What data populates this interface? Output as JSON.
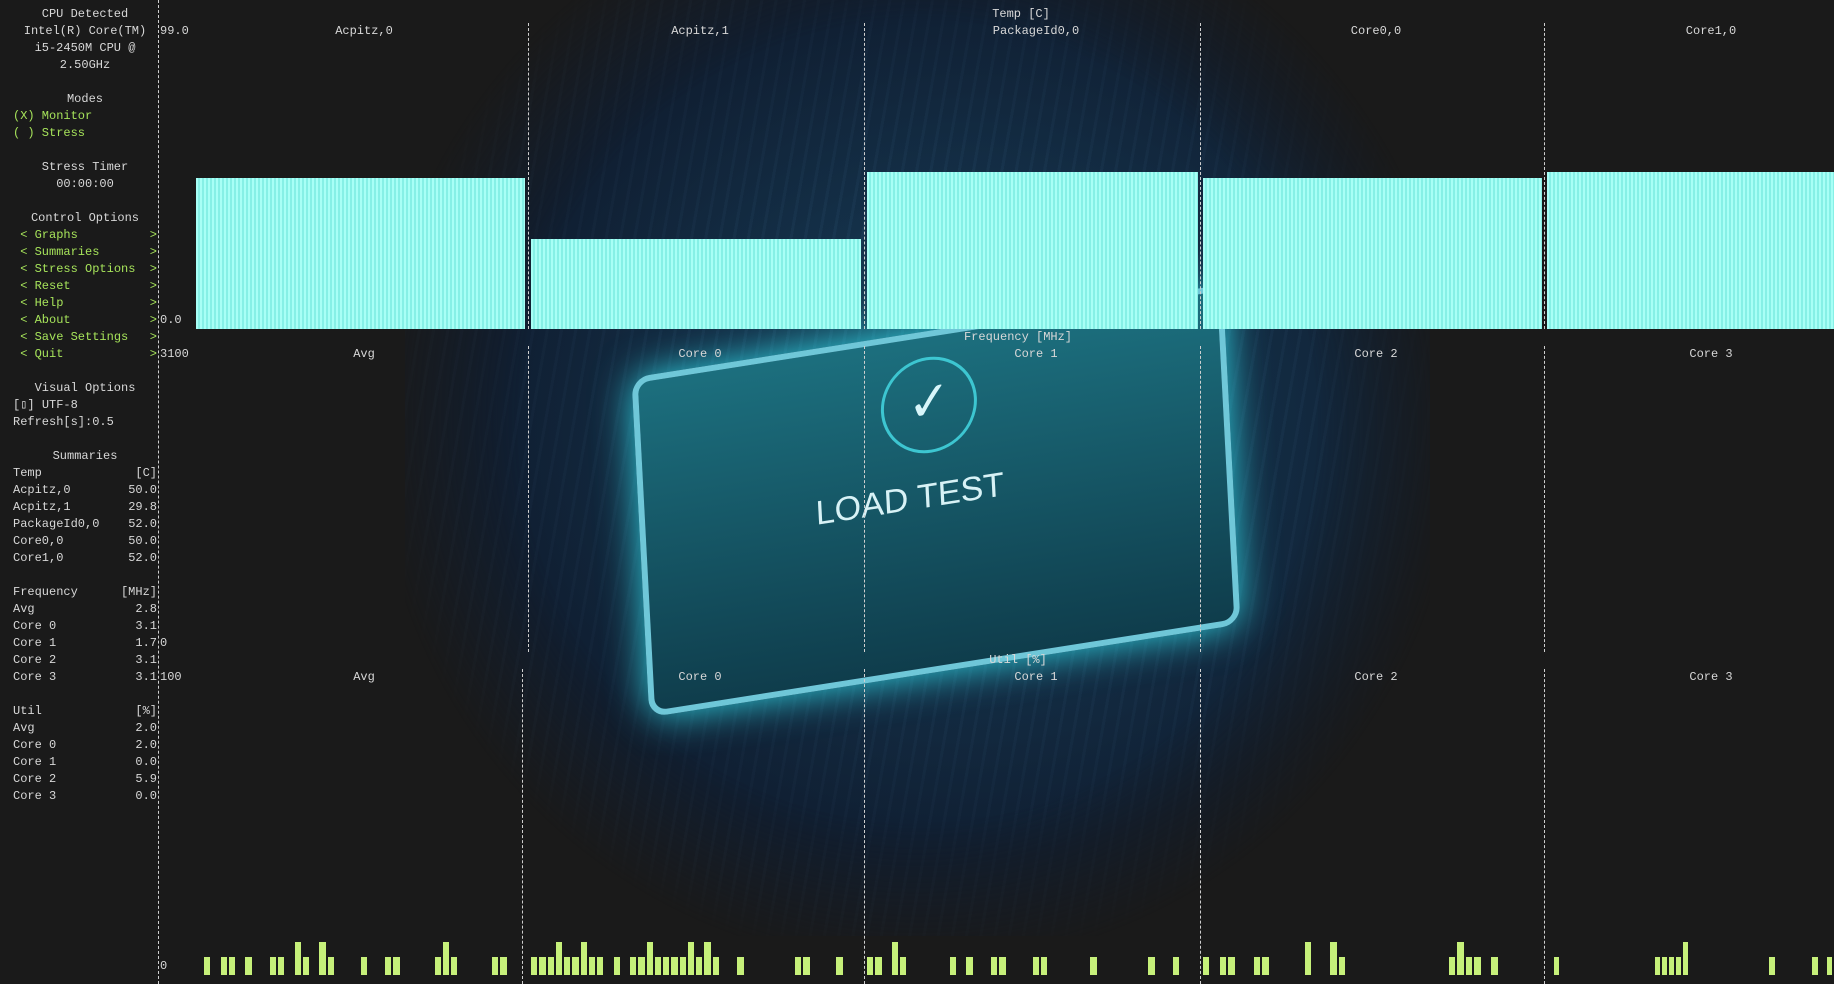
{
  "sidebar": {
    "cpu_title": "CPU Detected",
    "cpu_name": [
      "Intel(R) Core(TM)",
      "i5-2450M CPU @",
      "2.50GHz"
    ],
    "modes_title": "Modes",
    "modes": [
      {
        "mark": "(X)",
        "label": "Monitor"
      },
      {
        "mark": "( )",
        "label": "Stress"
      }
    ],
    "timer_title": "Stress Timer",
    "timer": "00:00:00",
    "control_title": "Control Options",
    "controls": [
      "Graphs",
      "Summaries",
      "Stress Options",
      "Reset",
      "Help",
      "About",
      "Save Settings",
      "Quit"
    ],
    "visual_title": "Visual Options",
    "utf8": "[▯] UTF-8",
    "refresh": "Refresh[s]:0.5",
    "summaries_title": "Summaries",
    "temp": {
      "header": "Temp",
      "unit": "[C]",
      "rows": [
        [
          "Acpitz,0",
          "50.0"
        ],
        [
          "Acpitz,1",
          "29.8"
        ],
        [
          "PackageId0,0",
          "52.0"
        ],
        [
          "Core0,0",
          "50.0"
        ],
        [
          "Core1,0",
          "52.0"
        ]
      ]
    },
    "freq": {
      "header": "Frequency",
      "unit": "[MHz]",
      "rows": [
        [
          "Avg",
          "2.8"
        ],
        [
          "Core 0",
          "3.1"
        ],
        [
          "Core 1",
          "1.7"
        ],
        [
          "Core 2",
          "3.1"
        ],
        [
          "Core 3",
          "3.1"
        ]
      ]
    },
    "util": {
      "header": "Util",
      "unit": "[%]",
      "rows": [
        [
          "Avg",
          "2.0"
        ],
        [
          "Core 0",
          "2.0"
        ],
        [
          "Core 1",
          "0.0"
        ],
        [
          "Core 2",
          "5.9"
        ],
        [
          "Core 3",
          "0.0"
        ]
      ]
    }
  },
  "graphs": {
    "temp": {
      "title": "Temp [C]",
      "max": "99.0",
      "min": "0.0",
      "ymax": 99,
      "labels": [
        "Acpitz,0",
        "Acpitz,1",
        "PackageId0,0",
        "Core0,0",
        "Core1,0"
      ],
      "values": [
        50.0,
        29.8,
        52.0,
        50.0,
        52.0
      ]
    },
    "freq": {
      "title": "Frequency [MHz]",
      "max": "3100",
      "min": "0",
      "labels": [
        "Avg",
        "Core 0",
        "Core 1",
        "Core 2",
        "Core 3"
      ]
    },
    "util": {
      "title": "Util [%]",
      "max": "100",
      "min": "0",
      "labels": [
        "Avg",
        "Core 0",
        "Core 1",
        "Core 2",
        "Core 3"
      ],
      "history": [
        [
          0,
          6,
          0,
          6,
          6,
          0,
          6,
          0,
          0,
          6,
          6,
          0,
          11,
          6,
          0,
          11,
          6,
          0,
          0,
          0,
          6,
          0,
          0,
          6,
          6,
          0,
          0,
          0,
          0,
          6,
          11,
          6,
          0,
          0,
          0,
          0,
          6,
          6,
          0,
          0
        ],
        [
          6,
          6,
          6,
          11,
          6,
          6,
          11,
          6,
          6,
          0,
          6,
          0,
          6,
          6,
          11,
          6,
          6,
          6,
          6,
          11,
          6,
          11,
          6,
          0,
          0,
          6,
          0,
          0,
          0,
          0,
          0,
          0,
          6,
          6,
          0,
          0,
          0,
          6,
          0,
          0
        ],
        [
          6,
          6,
          0,
          11,
          6,
          0,
          0,
          0,
          0,
          0,
          6,
          0,
          6,
          0,
          0,
          6,
          6,
          0,
          0,
          0,
          6,
          6,
          0,
          0,
          0,
          0,
          0,
          6,
          0,
          0,
          0,
          0,
          0,
          0,
          6,
          0,
          0,
          6,
          0,
          0
        ],
        [
          6,
          0,
          6,
          6,
          0,
          0,
          6,
          6,
          0,
          0,
          0,
          0,
          11,
          0,
          0,
          11,
          6,
          0,
          0,
          0,
          0,
          0,
          0,
          0,
          0,
          0,
          0,
          0,
          0,
          6,
          11,
          6,
          6,
          0,
          6,
          0,
          0,
          0,
          0,
          0
        ],
        [
          0,
          6,
          0,
          0,
          0,
          0,
          0,
          0,
          0,
          0,
          0,
          0,
          0,
          0,
          0,
          6,
          6,
          6,
          6,
          11,
          0,
          0,
          0,
          0,
          0,
          0,
          0,
          0,
          0,
          0,
          0,
          6,
          0,
          0,
          0,
          0,
          0,
          6,
          0,
          6
        ]
      ]
    }
  },
  "photo": {
    "text": "LOAD TEST"
  },
  "colors": {
    "accent": "#a6e35a",
    "temp_bar": "#a8fff6",
    "util_bar": "#c6f07a",
    "background": "#1a1a1a"
  }
}
